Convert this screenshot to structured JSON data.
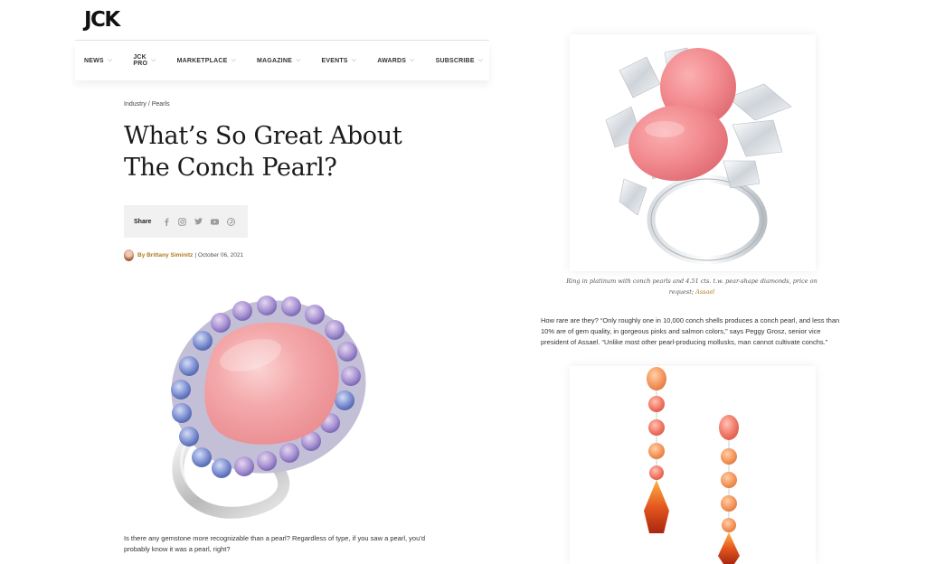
{
  "header": {
    "logo": "JCK",
    "nav": [
      {
        "label": "NEWS"
      },
      {
        "label": "JCK PRO"
      },
      {
        "label": "MARKETPLACE"
      },
      {
        "label": "MAGAZINE"
      },
      {
        "label": "EVENTS"
      },
      {
        "label": "AWARDS"
      },
      {
        "label": "SUBSCRIBE"
      }
    ]
  },
  "article": {
    "breadcrumb": "Industry / Pearls",
    "title": "What’s So Great About The Conch Pearl?",
    "share_label": "Share",
    "share_icons": [
      "facebook-icon",
      "instagram-icon",
      "twitter-icon",
      "youtube-icon",
      "pinterest-icon"
    ],
    "author": "By Brittany Siminitz",
    "date": "| October 06, 2021",
    "intro": "Is there any gemstone more recognizable than a pearl? Regardless of type, if you saw a pearl, you’d probably know it was a pearl, right?",
    "caption_text": "Ring in platinum with conch pearls and 4.51 cts. t.w. pear-shape diamonds, price on request; ",
    "caption_link": "Assael",
    "body_para": "How rare are they? “Only roughly one in 10,000 conch shells produces a conch pearl, and less than 10% are of gem quality, in gorgeous pinks and salmon colors,” says Peggy Grosz, senior vice president of Assael. “Unlike most other pearl-producing mollusks, man cannot cultivate conchs.”"
  },
  "colors": {
    "accent_link": "#b07a1e",
    "conch_pink": "#f08a8c",
    "share_bg": "#f1f1f1"
  }
}
